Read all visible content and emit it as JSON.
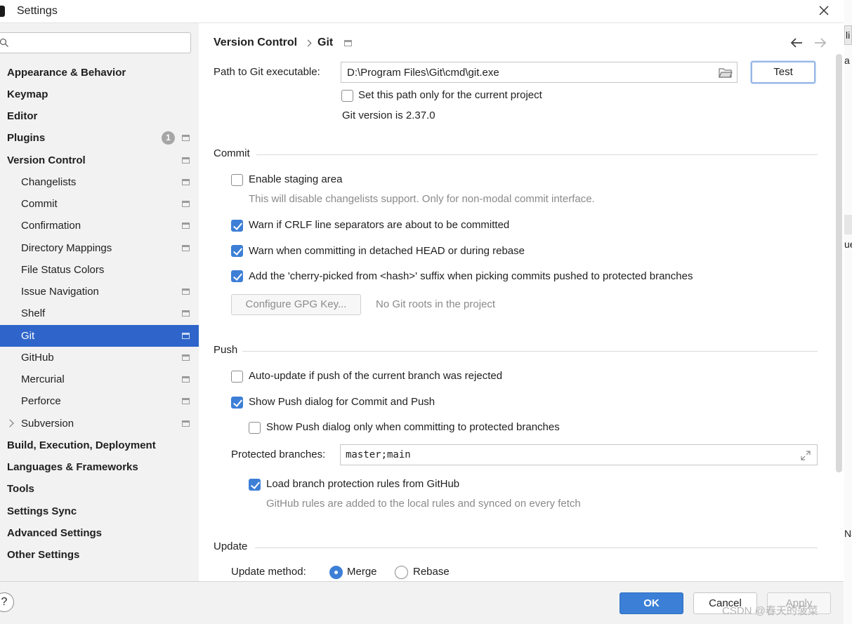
{
  "window": {
    "title": "Settings"
  },
  "sidebar": {
    "search": {
      "value": "",
      "placeholder": ""
    },
    "items": [
      {
        "label": "Appearance & Behavior",
        "bold": true
      },
      {
        "label": "Keymap",
        "bold": true
      },
      {
        "label": "Editor",
        "bold": true
      },
      {
        "label": "Plugins",
        "bold": true,
        "badge": "1"
      },
      {
        "label": "Version Control",
        "bold": true
      },
      {
        "label": "Changelists"
      },
      {
        "label": "Commit"
      },
      {
        "label": "Confirmation"
      },
      {
        "label": "Directory Mappings"
      },
      {
        "label": "File Status Colors"
      },
      {
        "label": "Issue Navigation"
      },
      {
        "label": "Shelf"
      },
      {
        "label": "Git",
        "selected": true
      },
      {
        "label": "GitHub"
      },
      {
        "label": "Mercurial"
      },
      {
        "label": "Perforce"
      },
      {
        "label": "Subversion"
      },
      {
        "label": "Build, Execution, Deployment",
        "bold": true
      },
      {
        "label": "Languages & Frameworks",
        "bold": true
      },
      {
        "label": "Tools",
        "bold": true
      },
      {
        "label": "Settings Sync",
        "bold": true
      },
      {
        "label": "Advanced Settings",
        "bold": true
      },
      {
        "label": "Other Settings",
        "bold": true
      }
    ]
  },
  "breadcrumb": {
    "parent": "Version Control",
    "current": "Git"
  },
  "git": {
    "path_label": "Path to Git executable:",
    "path_value": "D:\\Program Files\\Git\\cmd\\git.exe",
    "test_button": "Test",
    "set_path_only": "Set this path only for the current project",
    "version_text": "Git version is 2.37.0"
  },
  "commit": {
    "title": "Commit",
    "staging": "Enable staging area",
    "staging_hint": "This will disable changelists support. Only for non-modal commit interface.",
    "warn_crlf": "Warn if CRLF line separators are about to be committed",
    "warn_detached": "Warn when committing in detached HEAD or during rebase",
    "cherry_picked": "Add the 'cherry-picked from <hash>' suffix when picking commits pushed to protected branches",
    "gpg_button": "Configure GPG Key...",
    "gpg_status": "No Git roots in the project"
  },
  "push": {
    "title": "Push",
    "auto_update": "Auto-update if push of the current branch was rejected",
    "show_dialog": "Show Push dialog for Commit and Push",
    "show_dialog_protected": "Show Push dialog only when committing to protected branches",
    "protected_label": "Protected branches:",
    "protected_value": "master;main",
    "load_rules": "Load branch protection rules from GitHub",
    "load_rules_hint": "GitHub rules are added to the local rules and synced on every fetch"
  },
  "update": {
    "title": "Update",
    "method_label": "Update method:",
    "merge": "Merge",
    "rebase": "Rebase"
  },
  "footer": {
    "help": "?",
    "ok": "OK",
    "cancel": "Cancel",
    "apply": "Apply"
  },
  "watermark": "CSDN @春天的菠菜",
  "background_window": {
    "t1": "li",
    "t2": "a",
    "t3": "ue",
    "t4": "Na"
  },
  "colors": {
    "selection": "#2f65ca",
    "accent": "#3b7fd6",
    "window_bg": "#f2f2f2"
  }
}
